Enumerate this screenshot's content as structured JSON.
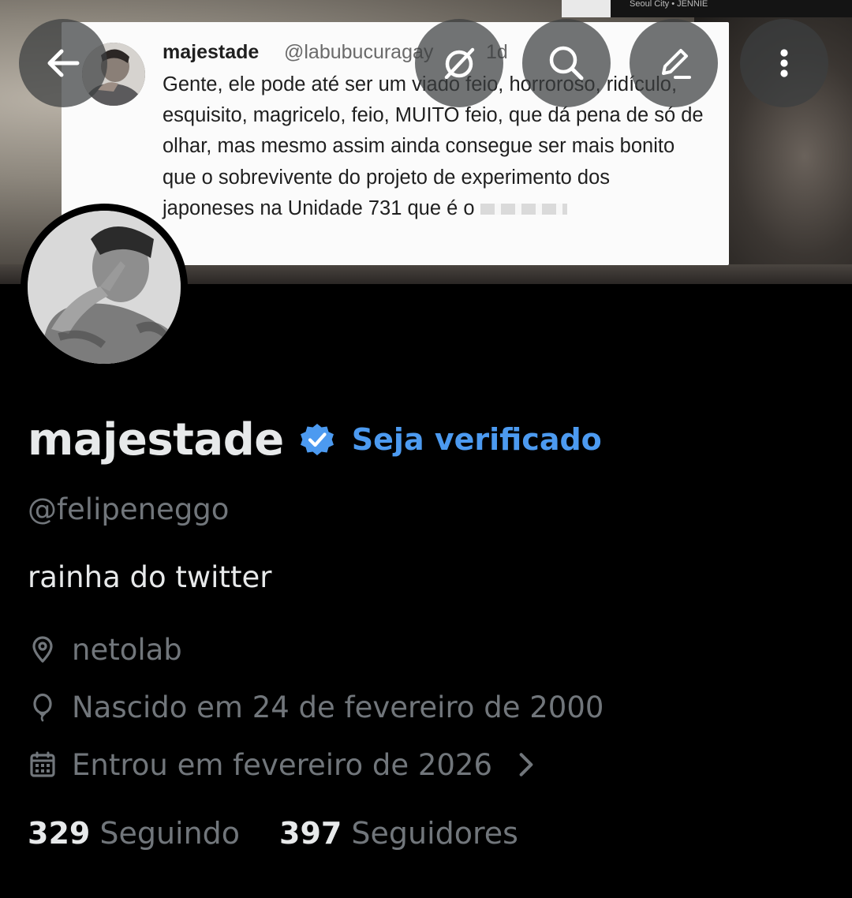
{
  "banner": {
    "caption": "Seoul City • JENNIE",
    "tweet": {
      "name": "majestade",
      "handle": "@labubucuragay",
      "time": "1d",
      "text": "Gente, ele pode até ser um viado feio, horroroso, ridículo, esquisito, magricelo, feio, MUITO feio, que dá pena de só de olhar, mas mesmo assim ainda consegue ser mais bonito que o sobrevivente do projeto de experimento dos japoneses na Unidade 731 que é o"
    }
  },
  "toolbar": {
    "back_icon": "arrow-left-icon",
    "grok_icon": "grok-icon",
    "search_icon": "search-icon",
    "edit_icon": "pencil-icon",
    "more_icon": "more-vertical-icon"
  },
  "profile": {
    "display_name": "majestade",
    "get_verified": "Seja verificado",
    "handle": "@felipeneggo",
    "bio": "rainha do twitter",
    "location": "netolab",
    "birthday": "Nascido em 24 de fevereiro de 2000",
    "joined": "Entrou em fevereiro de 2026",
    "following_count": "329",
    "following_label": "Seguindo",
    "followers_count": "397",
    "followers_label": "Seguidores"
  },
  "colors": {
    "background": "#000000",
    "text_primary": "#e7e9ea",
    "text_secondary": "#71767b",
    "accent": "#4c9af0"
  }
}
